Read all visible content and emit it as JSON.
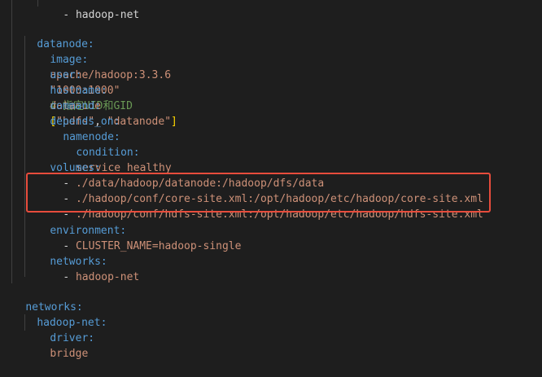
{
  "colors": {
    "background": "#1e1e1e",
    "key": "#569cd6",
    "string": "#ce9178",
    "comment": "#6a9955",
    "bracket": "#ffd700",
    "highlight_border": "#e74c3c"
  },
  "code": {
    "top_partial": "- hadoop-net",
    "datanode_key": "datanode:",
    "image_key": "image:",
    "image_val": "apache/hadoop:3.3.6",
    "user_key": "user:",
    "user_val": "\"1000:1000\"",
    "user_comment": "# 指定UID和GID",
    "hostname_key": "hostname:",
    "hostname_val": "datanode",
    "command_key": "command:",
    "command_open": "[",
    "command_a": "\"hdfs\"",
    "command_sep": ", ",
    "command_b": "\"datanode\"",
    "command_close": "]",
    "depends_key": "depends_on:",
    "namenode_key": "namenode:",
    "condition_key": "condition:",
    "condition_val": "service_healthy",
    "volumes_key": "volumes:",
    "vol_dash": "- ",
    "vol_1": "./data/hadoop/datanode:/hadoop/dfs/data",
    "vol_2": "./hadoop/conf/core-site.xml:/opt/hadoop/etc/hadoop/core-site.xml",
    "vol_3": "./hadoop/conf/hdfs-site.xml:/opt/hadoop/etc/hadoop/hdfs-site.xml",
    "environment_key": "environment:",
    "env_1": "CLUSTER_NAME=hadoop-single",
    "networks_key": "networks:",
    "net_item": "hadoop-net",
    "root_networks_key": "networks:",
    "hadoopnet_key": "hadoop-net:",
    "driver_key": "driver:",
    "driver_val": "bridge"
  }
}
